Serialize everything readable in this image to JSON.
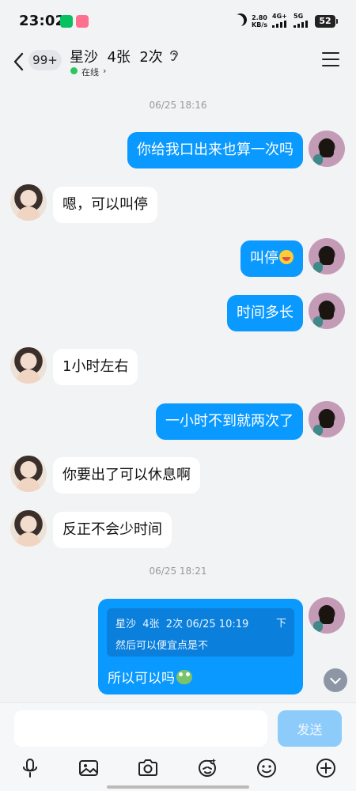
{
  "status_bar": {
    "time": "23:02",
    "net_speed_value": "2.80",
    "net_speed_unit": "KB/s",
    "sim1_label": "4G+",
    "sim2_label": "5G",
    "battery": "52"
  },
  "header": {
    "unread_count": "99+",
    "title": "星沙  4张  2次",
    "status": "在线",
    "status_chevron": "›"
  },
  "messages": {
    "ts1": "06/25 18:16",
    "m1": "你给我口出来也算一次吗",
    "m2": "嗯，可以叫停",
    "m3": "叫停",
    "m4": "时间多长",
    "m5": "1小时左右",
    "m6": "一小时不到就两次了",
    "m7": "你要出了可以休息啊",
    "m8": "反正不会少时间",
    "ts2": "06/25 18:21",
    "quote": {
      "meta": "星沙  4张  2次 06/25 10:19",
      "fold": "下",
      "text": "然后可以便宜点是不",
      "reply": "所以可以吗"
    }
  },
  "input": {
    "placeholder": "",
    "send_label": "发送"
  },
  "toolbar": {
    "icons": [
      "microphone-icon",
      "image-icon",
      "camera-icon",
      "sticker-icon",
      "emoji-icon",
      "plus-icon"
    ]
  },
  "colors": {
    "self_bubble": "#0a99ff",
    "other_bubble": "#ffffff",
    "background": "#f2f3f5",
    "online": "#2dc65c",
    "send_disabled": "#8dcbfb"
  }
}
